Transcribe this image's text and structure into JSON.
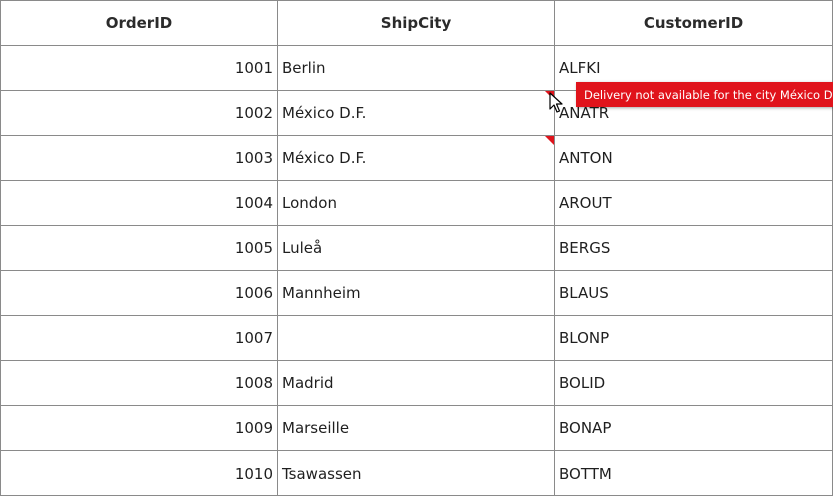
{
  "columns": [
    "OrderID",
    "ShipCity",
    "CustomerID"
  ],
  "rows": [
    {
      "order_id": "1001",
      "ship_city": "Berlin",
      "customer_id": "ALFKI",
      "error": false
    },
    {
      "order_id": "1002",
      "ship_city": "México D.F.",
      "customer_id": "ANATR",
      "error": true
    },
    {
      "order_id": "1003",
      "ship_city": "México D.F.",
      "customer_id": "ANTON",
      "error": true
    },
    {
      "order_id": "1004",
      "ship_city": "London",
      "customer_id": "AROUT",
      "error": false
    },
    {
      "order_id": "1005",
      "ship_city": "Luleå",
      "customer_id": "BERGS",
      "error": false
    },
    {
      "order_id": "1006",
      "ship_city": "Mannheim",
      "customer_id": "BLAUS",
      "error": false
    },
    {
      "order_id": "1007",
      "ship_city": "",
      "customer_id": "BLONP",
      "error": false
    },
    {
      "order_id": "1008",
      "ship_city": "Madrid",
      "customer_id": "BOLID",
      "error": false
    },
    {
      "order_id": "1009",
      "ship_city": "Marseille",
      "customer_id": "BONAP",
      "error": false
    },
    {
      "order_id": "1010",
      "ship_city": "Tsawassen",
      "customer_id": "BOTTM",
      "error": false
    }
  ],
  "tooltip": {
    "text": "Delivery not available for the city México D.F."
  },
  "colors": {
    "error": "#e0131b",
    "grid_line": "#8a8a8a"
  },
  "icons": {
    "error_indicator": "error-indicator-icon",
    "cursor": "mouse-cursor-icon"
  }
}
